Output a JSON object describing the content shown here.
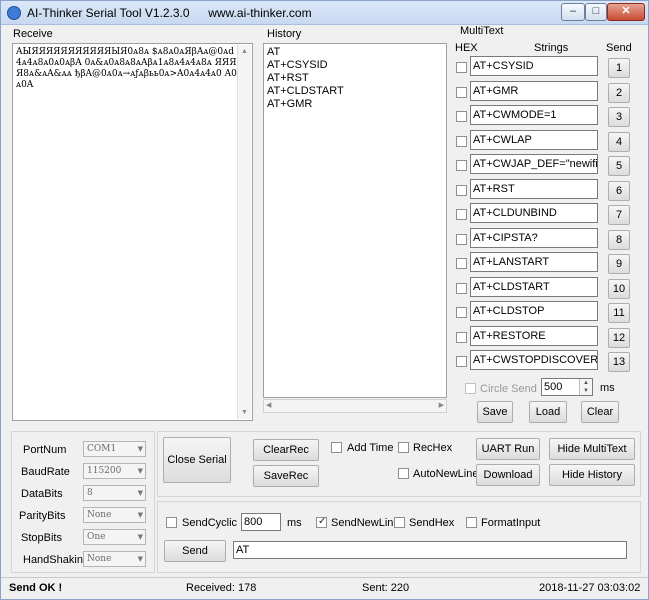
{
  "window": {
    "title": "AI-Thinker Serial Tool V1.2.3.0",
    "url": "www.ai-thinker.com",
    "minimize_glyph": "–",
    "maximize_glyph": "□",
    "close_glyph": "✕"
  },
  "receive": {
    "label": "Receive",
    "content": "AЫЯЯЯЯЯЯЯЯЯЯЯЫЯ0ᴀ8ᴀ $ᴀ8ᴀ0ᴀЯβAᴀ@0ᴀd4ᴀ4ᴀ8ᴀ0ᴀ0ᴀβA 0ᴀ&ᴀ0ᴀ8ᴀ8ᴀAβᴀ1ᴀ8ᴀ4ᴀ4ᴀ8ᴀ ЯЯЯЯ8ᴀ&ᴀA&ᴀᴀ ђβA@0ᴀ0ᴀ→ᴀƒᴀβьь0ᴀ>A0ᴀ4ᴀ4ᴀ0 A0ᴀ0A"
  },
  "history": {
    "label": "History",
    "items": [
      "AT",
      "AT+CSYSID",
      "AT+RST",
      "AT+CLDSTART",
      "AT+GMR"
    ]
  },
  "multitext": {
    "label": "MultiText",
    "col_hex": "HEX",
    "col_strings": "Strings",
    "col_send": "Send",
    "rows": [
      {
        "text": "AT+CSYSID",
        "num": "1"
      },
      {
        "text": "AT+GMR",
        "num": "2"
      },
      {
        "text": "AT+CWMODE=1",
        "num": "3"
      },
      {
        "text": "AT+CWLAP",
        "num": "4"
      },
      {
        "text": "AT+CWJAP_DEF=\"newifi_",
        "num": "5"
      },
      {
        "text": "AT+RST",
        "num": "6"
      },
      {
        "text": "AT+CLDUNBIND",
        "num": "7"
      },
      {
        "text": "AT+CIPSTA?",
        "num": "8"
      },
      {
        "text": "AT+LANSTART",
        "num": "9"
      },
      {
        "text": "AT+CLDSTART",
        "num": "10"
      },
      {
        "text": "AT+CLDSTOP",
        "num": "11"
      },
      {
        "text": "AT+RESTORE",
        "num": "12"
      },
      {
        "text": "AT+CWSTOPDISCOVER",
        "num": "13"
      }
    ],
    "circle_send_label": "Circle Send",
    "circle_interval": "500",
    "circle_unit": "ms",
    "save": "Save",
    "load": "Load",
    "clear": "Clear"
  },
  "port": {
    "portnum_label": "PortNum",
    "portnum_value": "COM1",
    "baud_label": "BaudRate",
    "baud_value": "115200",
    "databits_label": "DataBits",
    "databits_value": "8",
    "parity_label": "ParityBits",
    "parity_value": "None",
    "stopbits_label": "StopBits",
    "stopbits_value": "One",
    "handshake_label": "HandShaking",
    "handshake_value": "None"
  },
  "controls": {
    "close_serial": "Close Serial",
    "clear_rec": "ClearRec",
    "save_rec": "SaveRec",
    "add_time": "Add Time",
    "rec_hex": "RecHex",
    "auto_newline": "AutoNewLine",
    "uart_run": "UART Run",
    "download": "Download",
    "hide_multitext": "Hide MultiText",
    "hide_history": "Hide History"
  },
  "send": {
    "send_cyclic": "SendCyclic",
    "cyclic_value": "800",
    "cyclic_unit": "ms",
    "send_newline": "SendNewLin",
    "send_hex": "SendHex",
    "format_input": "FormatInput",
    "send_button": "Send",
    "input_value": "AT"
  },
  "status": {
    "message": "Send OK !",
    "received": "Received: 178",
    "sent": "Sent: 220",
    "datetime": "2018-11-27 03:03:02"
  }
}
